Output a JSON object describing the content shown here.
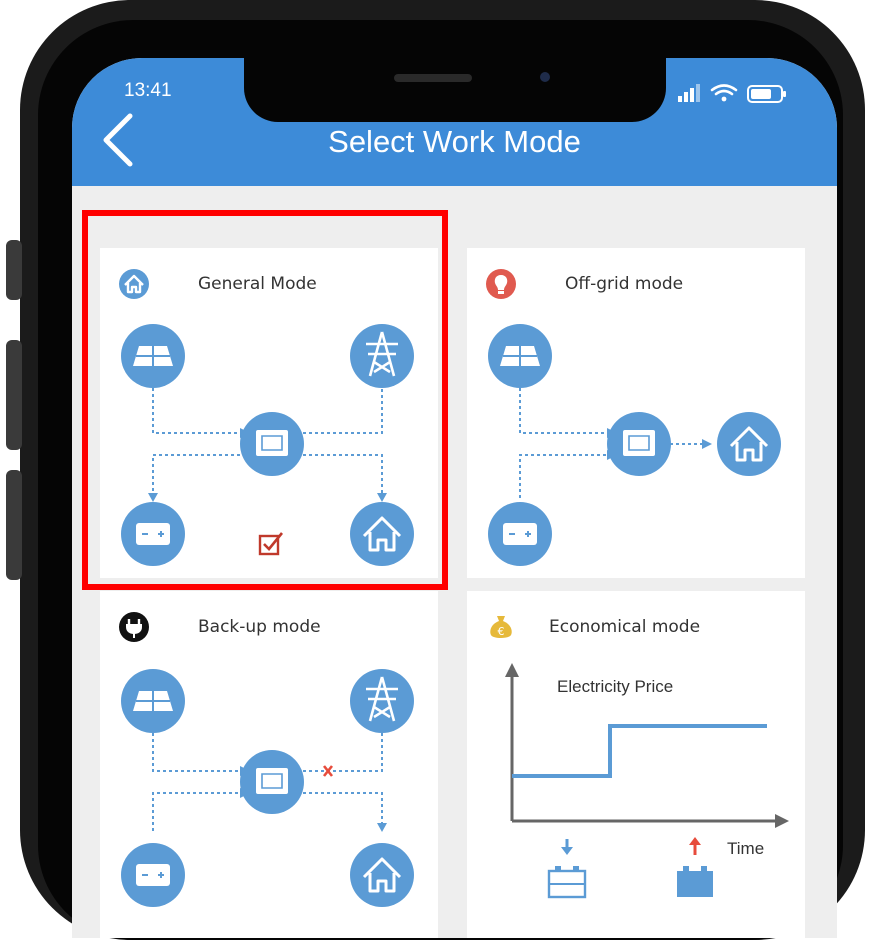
{
  "status_bar": {
    "time": "13:41",
    "icons": [
      "signal-icon",
      "wifi-icon",
      "battery-icon"
    ]
  },
  "header": {
    "title": "Select Work Mode",
    "back_icon": "chevron-left-icon"
  },
  "modes": [
    {
      "id": "general",
      "title": "General Mode",
      "icon": "home-icon",
      "selected": true
    },
    {
      "id": "offgrid",
      "title": "Off-grid mode",
      "icon": "lightbulb-icon",
      "selected": false
    },
    {
      "id": "backup",
      "title": "Back-up mode",
      "icon": "plug-icon",
      "selected": false
    },
    {
      "id": "economical",
      "title": "Economical mode",
      "icon": "money-bag-icon",
      "selected": false
    }
  ],
  "economical_chart": {
    "title": "Electricity Price",
    "x_label": "Time"
  },
  "colors": {
    "header": "#3d8bd8",
    "node": "#5b9bd5",
    "highlight": "#ff0000",
    "check": "#c0392b",
    "arrow_down": "#5b9bd5",
    "arrow_up": "#e74c3c"
  }
}
